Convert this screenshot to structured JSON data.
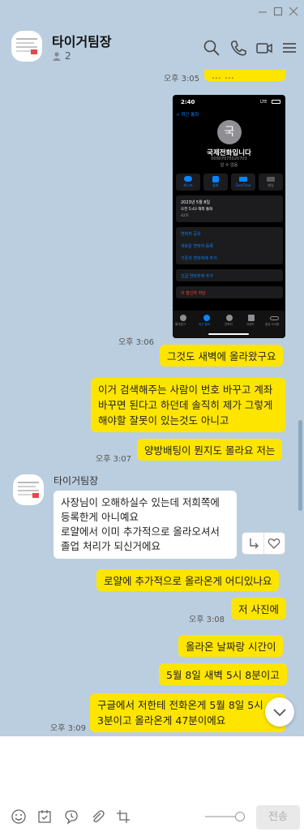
{
  "header": {
    "title": "타이거팀장",
    "member_count": "2",
    "icons": [
      "search-icon",
      "call-icon",
      "video-call-icon",
      "menu-icon"
    ]
  },
  "messages": {
    "top_time": "오후 3:05",
    "top_partial_text": "... ...",
    "photo_time": "",
    "m1_time": "오후 3:06",
    "m1_text": "그것도 새벽에 올라왔구요",
    "m2_text": "이거 검색해주는 사람이 번호 바꾸고 계좌 바꾸면 된다고 하던데 솔직히 제가 그렇게 해야할 잘못이 있는것도 아니고",
    "m3_time": "오후 3:07",
    "m3_text": "양방배팅이 뭔지도 몰라요 저는",
    "sender_name": "타이거팀장",
    "other_text": "사장님이 오해하실수 있는데 저희쪽에 등록한게 아니예요\n로얄에서 이미 추가적으로 올라오셔서 졸업 처리가 되신거에요",
    "m4_text": "로얄에 추가적으로 올라온게 어디있나요",
    "m5_time": "오후 3:08",
    "m5_text": "저 사진에",
    "m6_text": "올라온 날짜랑 시간이",
    "m7_text": "5월 8일 새벽 5시 8분이고",
    "m8_time": "오후 3:09",
    "m8_text": "구글에서 저한테 전화온게 5월 8일 5시 3분이고 올라온게 47분이에요"
  },
  "photo": {
    "status_time": "2:40",
    "status_right": "LTE",
    "back_label": "< 최근 통화",
    "avatar_char": "국",
    "caller_name": "국제전화입니다",
    "caller_number": "00907075020703",
    "caller_sub": "알 수 없음",
    "actions": [
      "메시지",
      "통화",
      "FaceTime",
      "메일"
    ],
    "date_line": "2023년 5월 8일",
    "call_line": "오전 5:43  해외 통화",
    "duration_line": "42초",
    "menu_items": [
      "연락처 공유",
      "새로운 연락처 등록",
      "기존의 연락처에 추가"
    ],
    "emergency_item": "긴급 연락처에 추가",
    "block_item": "이 발신자 차단",
    "tabs": [
      "즐겨찾기",
      "최근 통화",
      "연락처",
      "키패드",
      "음성 사서함"
    ]
  },
  "input": {
    "placeholder": "",
    "send_label": "전송",
    "toolbar_icons": [
      "emoticon-icon",
      "calendar-icon",
      "bubble-icon",
      "attach-icon",
      "crop-icon"
    ]
  },
  "colors": {
    "background": "#bacee0",
    "my_bubble": "#fee500",
    "other_bubble": "#ffffff",
    "danger": "#ff453a",
    "link": "#0a84ff"
  }
}
